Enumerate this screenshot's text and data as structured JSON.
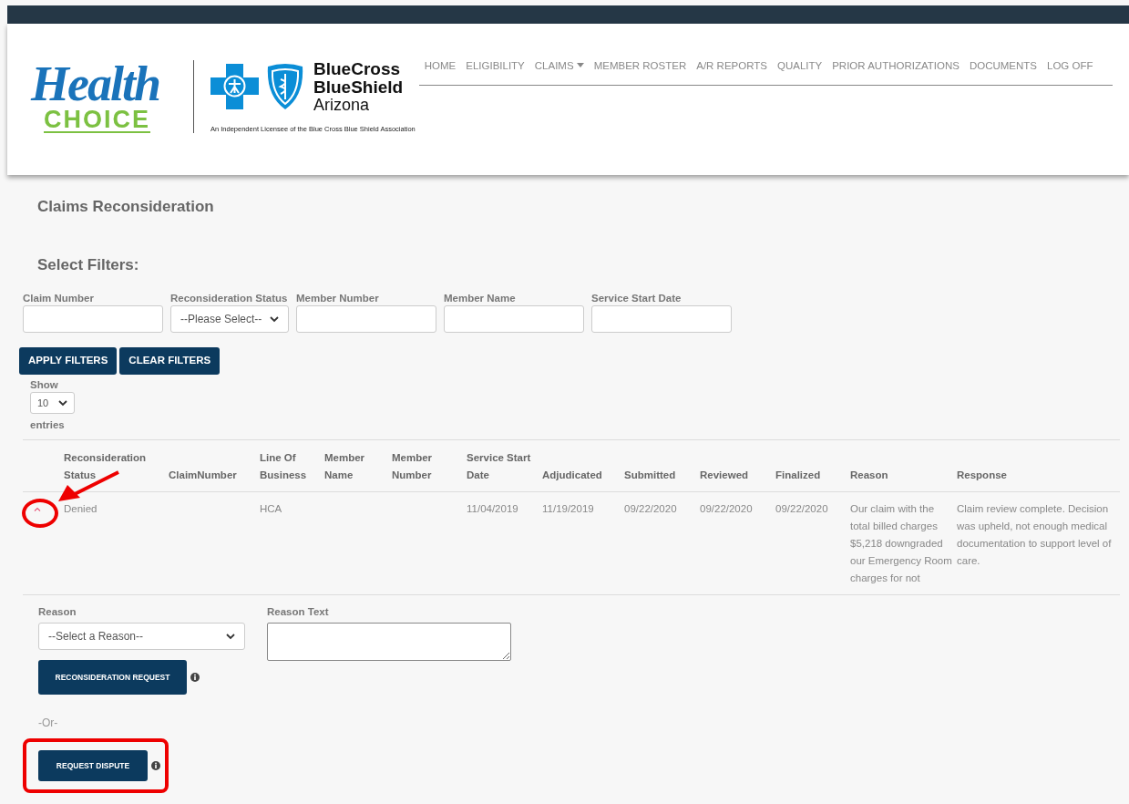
{
  "header": {
    "logo": {
      "word": "Health",
      "subword": "CHOICE"
    },
    "partner": {
      "line1": "BlueCross",
      "line2": "BlueShield",
      "line3": "Arizona",
      "tagline": "An Independent Licensee of the Blue Cross Blue Shield Association"
    }
  },
  "nav": [
    {
      "label": "HOME",
      "dropdown": false
    },
    {
      "label": "ELIGIBILITY",
      "dropdown": false
    },
    {
      "label": "CLAIMS",
      "dropdown": true
    },
    {
      "label": "MEMBER ROSTER",
      "dropdown": false
    },
    {
      "label": "A/R REPORTS",
      "dropdown": false
    },
    {
      "label": "QUALITY",
      "dropdown": false
    },
    {
      "label": "PRIOR AUTHORIZATIONS",
      "dropdown": false
    },
    {
      "label": "DOCUMENTS",
      "dropdown": false
    },
    {
      "label": "LOG OFF",
      "dropdown": false
    }
  ],
  "page_title": "Claims Reconsideration",
  "filters": {
    "heading": "Select Filters:",
    "fields": [
      {
        "label": "Claim Number",
        "kind": "text"
      },
      {
        "label": "Reconsideration Status",
        "kind": "select",
        "value": "--Please Select--"
      },
      {
        "label": "Member Number",
        "kind": "text"
      },
      {
        "label": "Member Name",
        "kind": "text"
      },
      {
        "label": "Service Start Date",
        "kind": "text"
      }
    ],
    "buttons": [
      "APPLY FILTERS",
      "CLEAR FILTERS"
    ]
  },
  "page_length": {
    "show": "Show",
    "value": "10",
    "entries": "entries"
  },
  "table": {
    "columns": [
      "Reconsideration Status",
      "ClaimNumber",
      "Line Of Business",
      "Member Name",
      "Member Number",
      "Service Start Date",
      "Adjudicated",
      "Submitted",
      "Reviewed",
      "Finalized",
      "Reason",
      "Response"
    ],
    "rows": [
      {
        "expanded": true,
        "cells": [
          "Denied",
          null,
          "HCA",
          null,
          null,
          "11/04/2019",
          "11/19/2019",
          "09/22/2020",
          "09/22/2020",
          "09/22/2020",
          "Our claim with the total billed charges $5,218 downgraded our Emergency Room charges for not",
          "Claim review complete. Decision was upheld, not enough medical documentation to support level of care."
        ],
        "detail": {
          "reason_label": "Reason",
          "reason_select": "--Select a Reason--",
          "reason_text_label": "Reason Text",
          "reconsideration_button": "RECONSIDERATION REQUEST",
          "or": "-Or-",
          "dispute_button": "REQUEST DISPUTE"
        }
      }
    ]
  }
}
